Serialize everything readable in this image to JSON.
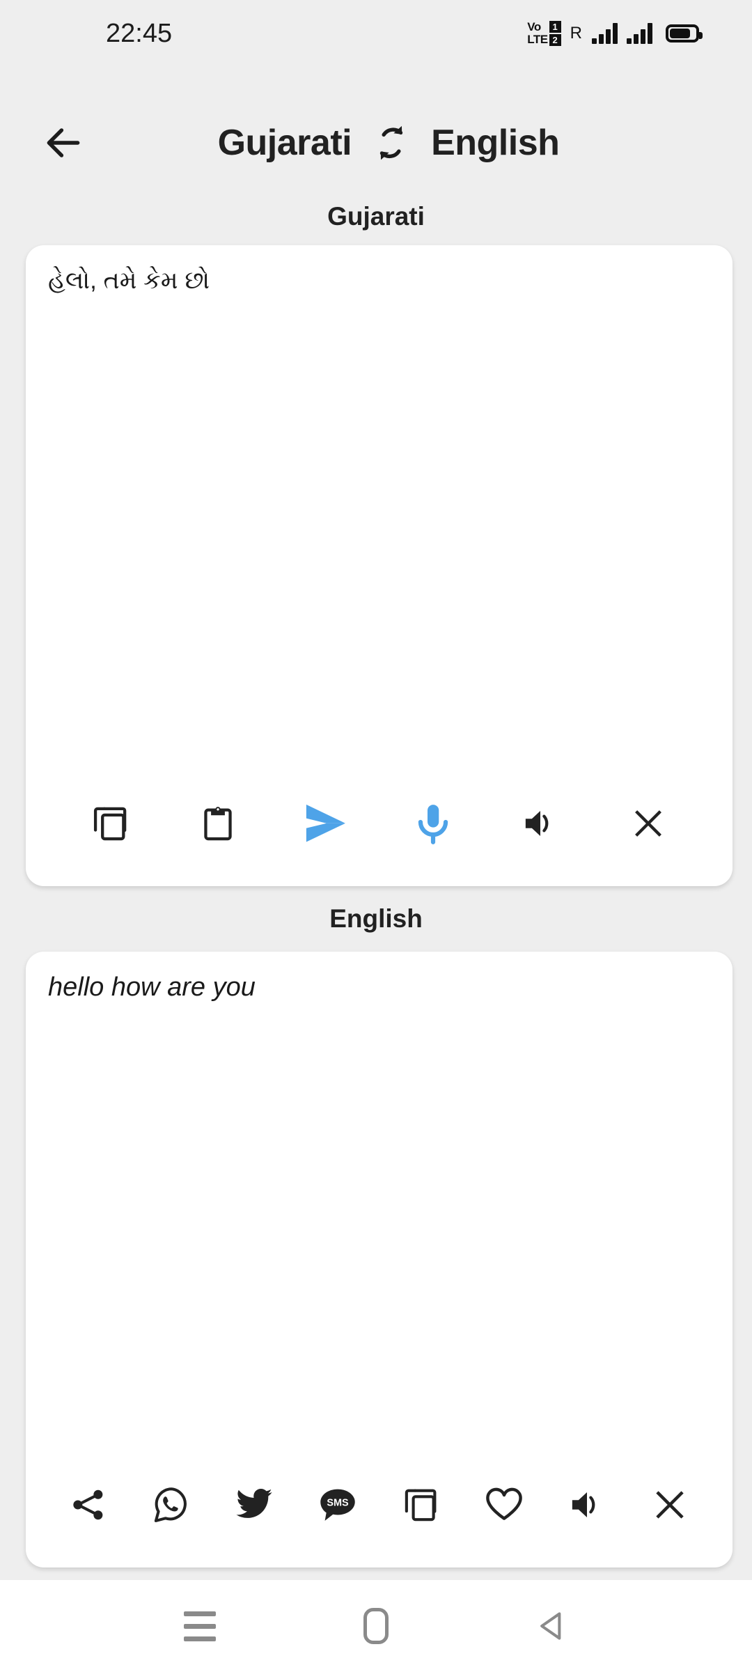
{
  "status_bar": {
    "time": "22:45",
    "volte_label_top": "Vo",
    "volte_label_bottom": "LTE",
    "sim_one": "1",
    "sim_two": "2",
    "roaming": "R",
    "battery_level": "72"
  },
  "header": {
    "back_icon": "arrow-left-icon",
    "source_language": "Gujarati",
    "swap_icon": "swap-languages-icon",
    "target_language": "English"
  },
  "source_panel": {
    "label": "Gujarati",
    "text": "હેલો, તમે કેમ છો",
    "toolbar": [
      {
        "name": "copy-button",
        "icon": "copy-icon",
        "color": "#222222"
      },
      {
        "name": "paste-button",
        "icon": "clipboard-icon",
        "color": "#222222"
      },
      {
        "name": "translate-button",
        "icon": "send-arrow-icon",
        "color": "#4ea3e8"
      },
      {
        "name": "voice-input-button",
        "icon": "microphone-icon",
        "color": "#4ea3e8"
      },
      {
        "name": "speak-button",
        "icon": "speaker-icon",
        "color": "#222222"
      },
      {
        "name": "clear-button",
        "icon": "close-icon",
        "color": "#222222"
      }
    ]
  },
  "target_panel": {
    "label": "English",
    "text": "hello how are you",
    "toolbar": [
      {
        "name": "share-button",
        "icon": "share-icon",
        "color": "#222222"
      },
      {
        "name": "whatsapp-button",
        "icon": "whatsapp-icon",
        "color": "#222222"
      },
      {
        "name": "twitter-button",
        "icon": "twitter-icon",
        "color": "#222222"
      },
      {
        "name": "sms-button",
        "icon": "sms-icon",
        "color": "#222222",
        "label": "SMS"
      },
      {
        "name": "copy-button",
        "icon": "copy-icon",
        "color": "#222222"
      },
      {
        "name": "favorite-button",
        "icon": "heart-icon",
        "color": "#222222"
      },
      {
        "name": "speak-button",
        "icon": "speaker-icon",
        "color": "#222222"
      },
      {
        "name": "clear-button",
        "icon": "close-icon",
        "color": "#222222"
      }
    ]
  },
  "nav_bar": {
    "recents_icon": "menu-lines-icon",
    "home_icon": "home-square-icon",
    "back_icon": "back-triangle-icon"
  },
  "colors": {
    "background": "#eeeeee",
    "card": "#ffffff",
    "accent_blue": "#4ea3e8",
    "text_primary": "#212121",
    "nav_icon": "#8a8a8a"
  }
}
